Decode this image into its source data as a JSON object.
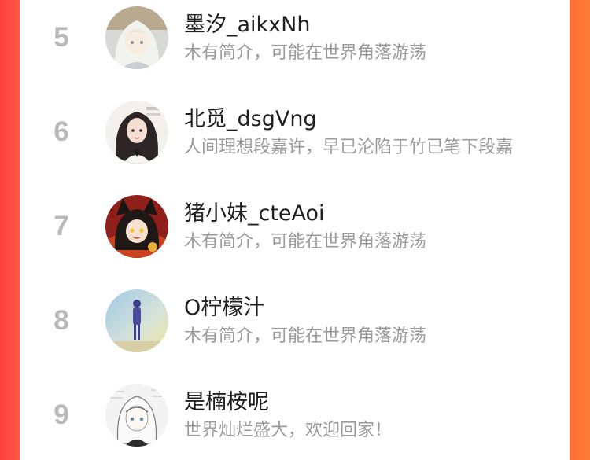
{
  "colors": {
    "background_gradient_start": "#ff3f43",
    "background_gradient_end": "#ff7a34",
    "rank_color": "#b9b9b9",
    "name_color": "#1f1f1f",
    "bio_color": "#9a9a9a"
  },
  "ranking": {
    "items": [
      {
        "rank": "5",
        "name": "墨汐_aikxNh",
        "bio": "木有简介，可能在世界角落游荡",
        "avatar_icon": "avatar-white-hair-girl"
      },
      {
        "rank": "6",
        "name": "北觅_dsgVng",
        "bio": "人间理想段嘉许，早已沦陷于竹已笔下段嘉",
        "avatar_icon": "avatar-dark-hair-girl"
      },
      {
        "rank": "7",
        "name": "猪小妹_cteAoi",
        "bio": "木有简介，可能在世界角落游荡",
        "avatar_icon": "avatar-cat-ear-girl"
      },
      {
        "rank": "8",
        "name": "O柠檬汁",
        "bio": "木有简介，可能在世界角落游荡",
        "avatar_icon": "avatar-silhouette-sky"
      },
      {
        "rank": "9",
        "name": "是楠桉呢",
        "bio": "世界灿烂盛大，欢迎回家！",
        "avatar_icon": "avatar-sketch-girl"
      }
    ]
  }
}
